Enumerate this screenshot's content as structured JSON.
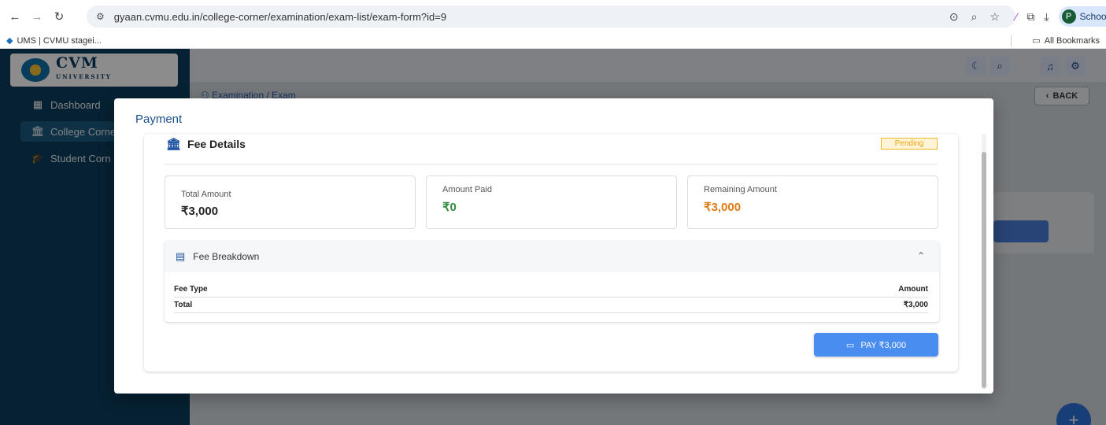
{
  "browser": {
    "url": "gyaan.cvmu.edu.in/college-corner/examination/exam-list/exam-form?id=9",
    "profile_initial": "P",
    "profile_label": "School",
    "bookmark_left": "UMS | CVMU stagei...",
    "bookmark_right": "All Bookmarks"
  },
  "sidebar": {
    "logo_text": "CVM",
    "logo_sub": "UNIVERSITY",
    "items": [
      {
        "label": "Dashboard",
        "icon": "dashboard-grid-icon"
      },
      {
        "label": "College Corne",
        "icon": "bank-icon"
      },
      {
        "label": "Student Corn",
        "icon": "graduation-cap-icon"
      }
    ]
  },
  "header": {
    "breadcrumb": "Examination / Exam",
    "back_label": "BACK"
  },
  "modal": {
    "title": "Payment",
    "fee_title": "Fee Details",
    "status": "Pending",
    "total_label": "Total Amount",
    "total_value": "₹3,000",
    "paid_label": "Amount Paid",
    "paid_value": "₹0",
    "remaining_label": "Remaining Amount",
    "remaining_value": "₹3,000",
    "breakdown_title": "Fee Breakdown",
    "col_type": "Fee Type",
    "col_amount": "Amount",
    "total_row_label": "Total",
    "total_row_value": "₹3,000",
    "pay_label": "PAY ₹3,000"
  },
  "colors": {
    "sidebar_bg": "#0b3d5c",
    "paid_green": "#2e8b3d",
    "remaining_orange": "#e07a12",
    "pay_button": "#4a8df0",
    "pending_badge": "#e8a51a"
  }
}
